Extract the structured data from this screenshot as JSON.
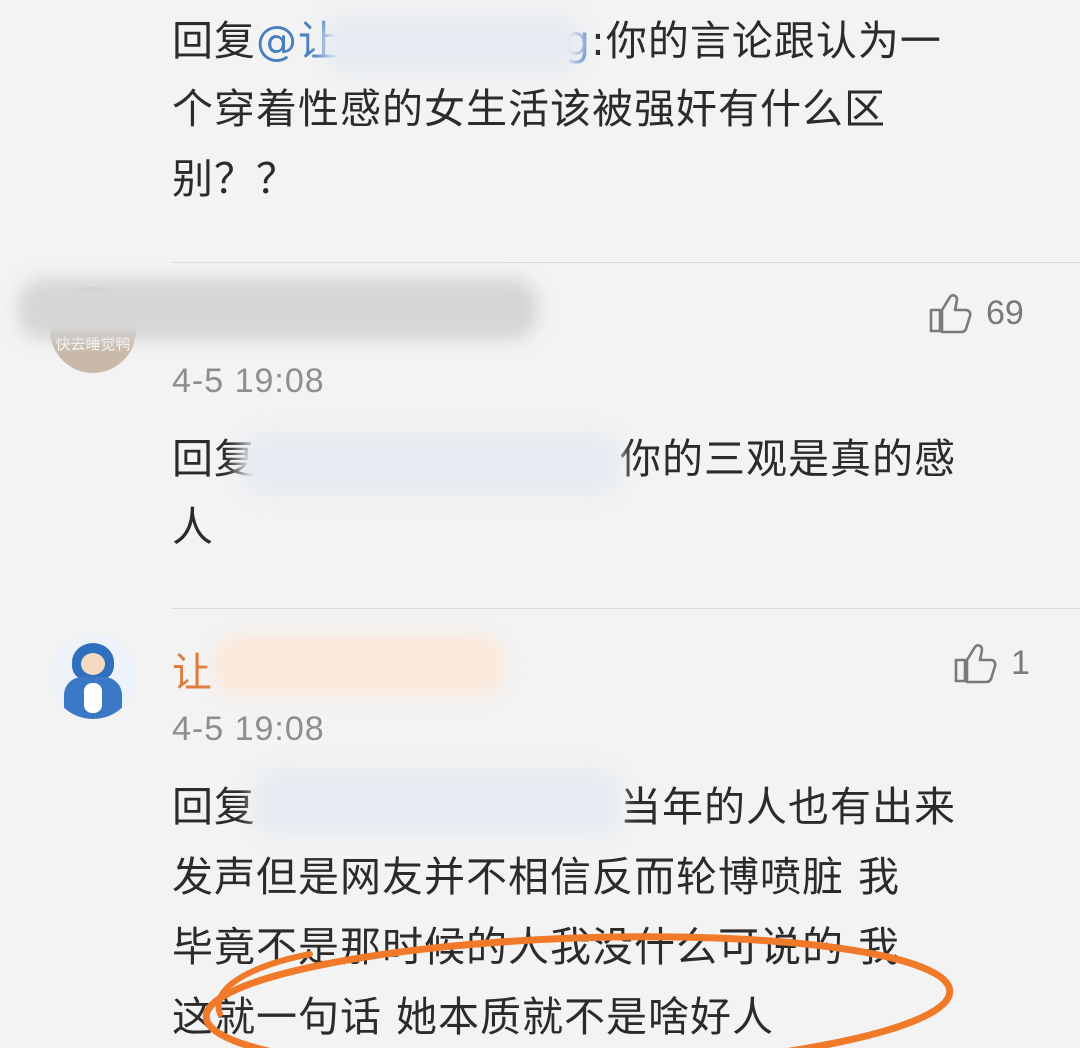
{
  "comment1": {
    "line1_prefix": "回复",
    "mention_start": "@让",
    "mention_end": "g",
    "line1_suffix": ":你的言论跟认为一",
    "line2": "个穿着性感的女生活该被强奸有什么区",
    "line3": "别？？"
  },
  "comment2": {
    "avatar_text": "快去睡觉鸭",
    "likes": "69",
    "timestamp": "4-5 19:08",
    "line1_prefix": "回复",
    "line1_suffix": "你的三观是真的感",
    "line2": "人"
  },
  "comment3": {
    "username": "让",
    "likes": "1",
    "timestamp": "4-5 19:08",
    "line1_prefix": "回复",
    "line1_suffix": "当年的人也有出来",
    "line2": "发声但是网友并不相信反而轮博喷脏 我",
    "line3": "毕竟不是那时候的人我没什么可说的 我",
    "line4": "这就一句话 她本质就不是啥好人"
  },
  "colors": {
    "mention": "#4a7fbf",
    "username": "#e07a3a",
    "annotation_circle": "#f07a2a"
  }
}
